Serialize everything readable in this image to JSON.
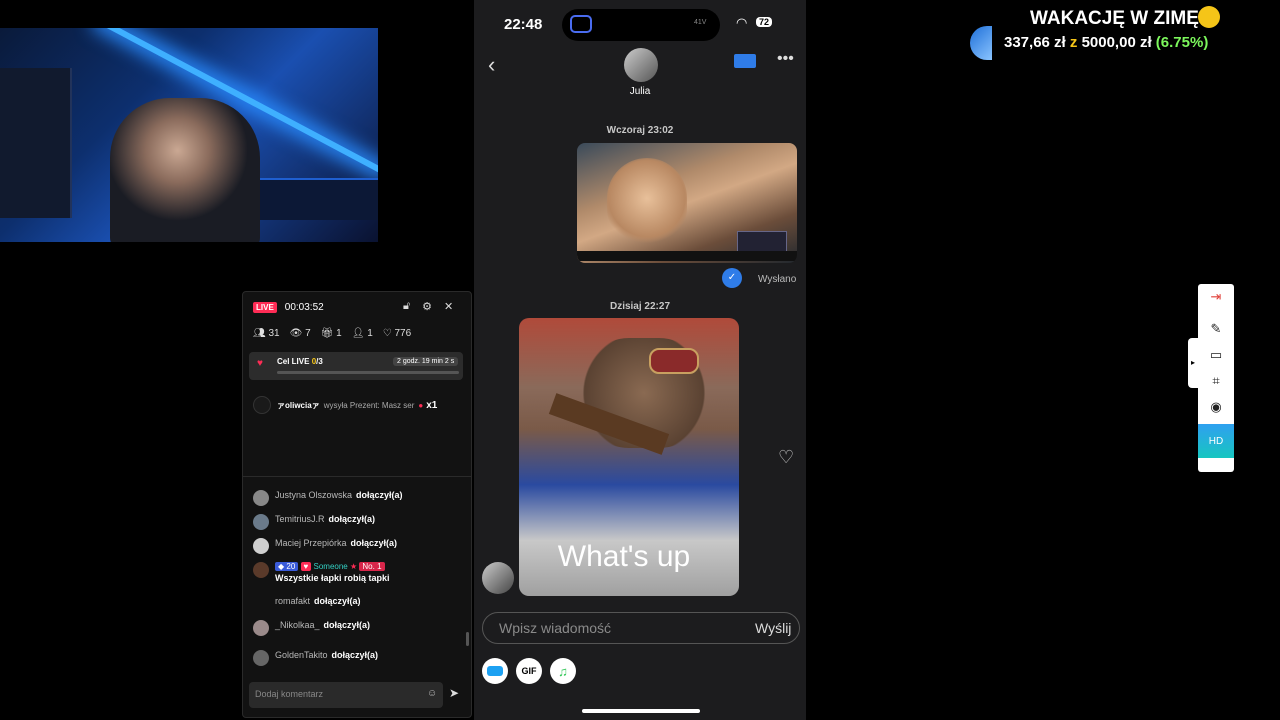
{
  "phone": {
    "time": "22:48",
    "tv_label": "41V",
    "battery": "72",
    "contact_name": "Julia",
    "date_yesterday": "Wczoraj 23:02",
    "sent_status": "Wysłano",
    "date_today": "Dzisiaj 22:27",
    "meme_caption": "What's up",
    "input_placeholder": "Wpisz wiadomość",
    "send_label": "Wyślij",
    "gif_label": "GIF"
  },
  "live": {
    "badge": "LIVE",
    "timer": "00:03:52",
    "stats": {
      "viewers": "31",
      "views": "7",
      "gifts": "1",
      "follows": "1",
      "likes": "776"
    },
    "goal_label": "Cel LIVE",
    "goal_current": "0",
    "goal_total": "/3",
    "goal_time": "2 godz. 19 min 2 s",
    "gift_user": "ァoliwciaァ",
    "gift_text": "wysyła Prezent: Masz ser",
    "gift_count": "x1",
    "comments": [
      {
        "user": "Justyna Olszowska",
        "text": "dołączył(a)"
      },
      {
        "user": "TemitriusJ.R",
        "text": "dołączył(a)"
      },
      {
        "user": "Maciej Przepiórka",
        "text": "dołączył(a)"
      }
    ],
    "special": {
      "level": "20",
      "user": "Someone",
      "rank": "No. 1",
      "message": "Wszystkie łapki robią tapki"
    },
    "comments2": [
      {
        "user": "romafakt",
        "text": "dołączył(a)"
      },
      {
        "user": "_Nikolkaa_",
        "text": "dołączył(a)"
      },
      {
        "user": "GoldenTakito",
        "text": "dołączył(a)"
      }
    ],
    "comment_placeholder": "Dodaj komentarz"
  },
  "banner": {
    "title": "WAKACJĘ W ZIMĘ",
    "current": "337,66 zł",
    "sep": "z",
    "target": "5000,00 zł",
    "percent": "(6.75%)"
  },
  "toolbar": {
    "hd_label": "HD"
  }
}
